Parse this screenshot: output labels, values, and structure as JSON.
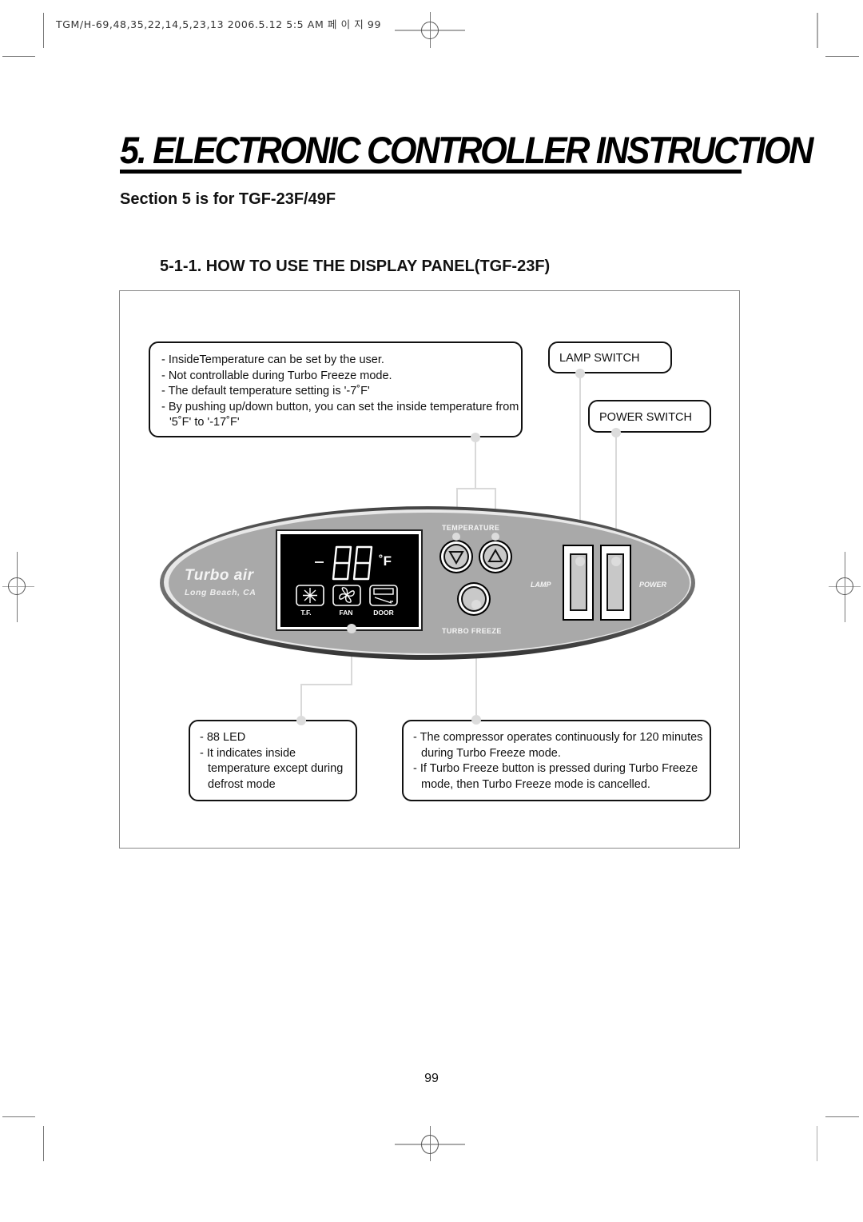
{
  "print_slug": "TGM/H-69,48,35,22,14,5,23,13  2006.5.12 5:5 AM 페 이 지 99",
  "page_title": "5. ELECTRONIC CONTROLLER INSTRUCTION",
  "section_note": "Section 5 is for TGF-23F/49F",
  "subsection_title": "5-1-1. HOW TO USE THE DISPLAY PANEL(TGF-23F)",
  "callouts": {
    "temperature": {
      "lines": [
        "- InsideTemperature can be set by the user.",
        "- Not controllable during Turbo Freeze mode.",
        "- The default temperature setting is '-7˚F'",
        "- By pushing up/down button, you can set the inside temperature from '5˚F' to '-17˚F'"
      ]
    },
    "lamp_switch": {
      "label": "LAMP SWITCH"
    },
    "power_switch": {
      "label": "POWER SWITCH"
    },
    "led": {
      "lines": [
        "- 88 LED",
        "- It indicates inside temperature except during defrost mode"
      ]
    },
    "turbo_freeze": {
      "lines": [
        "- The compressor operates continuously for 120 minutes during Turbo Freeze mode.",
        "- If Turbo Freeze button is pressed during Turbo Freeze mode, then Turbo Freeze mode is cancelled."
      ]
    }
  },
  "panel": {
    "brand": "Turbo air",
    "location": "Long Beach, CA",
    "display": {
      "minus_sign": "−",
      "digits": "88",
      "unit": "˚F",
      "indicators": [
        {
          "label": "T.F.",
          "icon": "snowflake-icon"
        },
        {
          "label": "FAN",
          "icon": "fan-icon"
        },
        {
          "label": "DOOR",
          "icon": "door-icon"
        }
      ]
    },
    "temperature_label": "TEMPERATURE",
    "down_button_symbol": "▽",
    "up_button_symbol": "△",
    "turbo_freeze_label": "TURBO FREEZE",
    "lamp_label": "LAMP",
    "power_label": "POWER"
  },
  "page_number": "99"
}
